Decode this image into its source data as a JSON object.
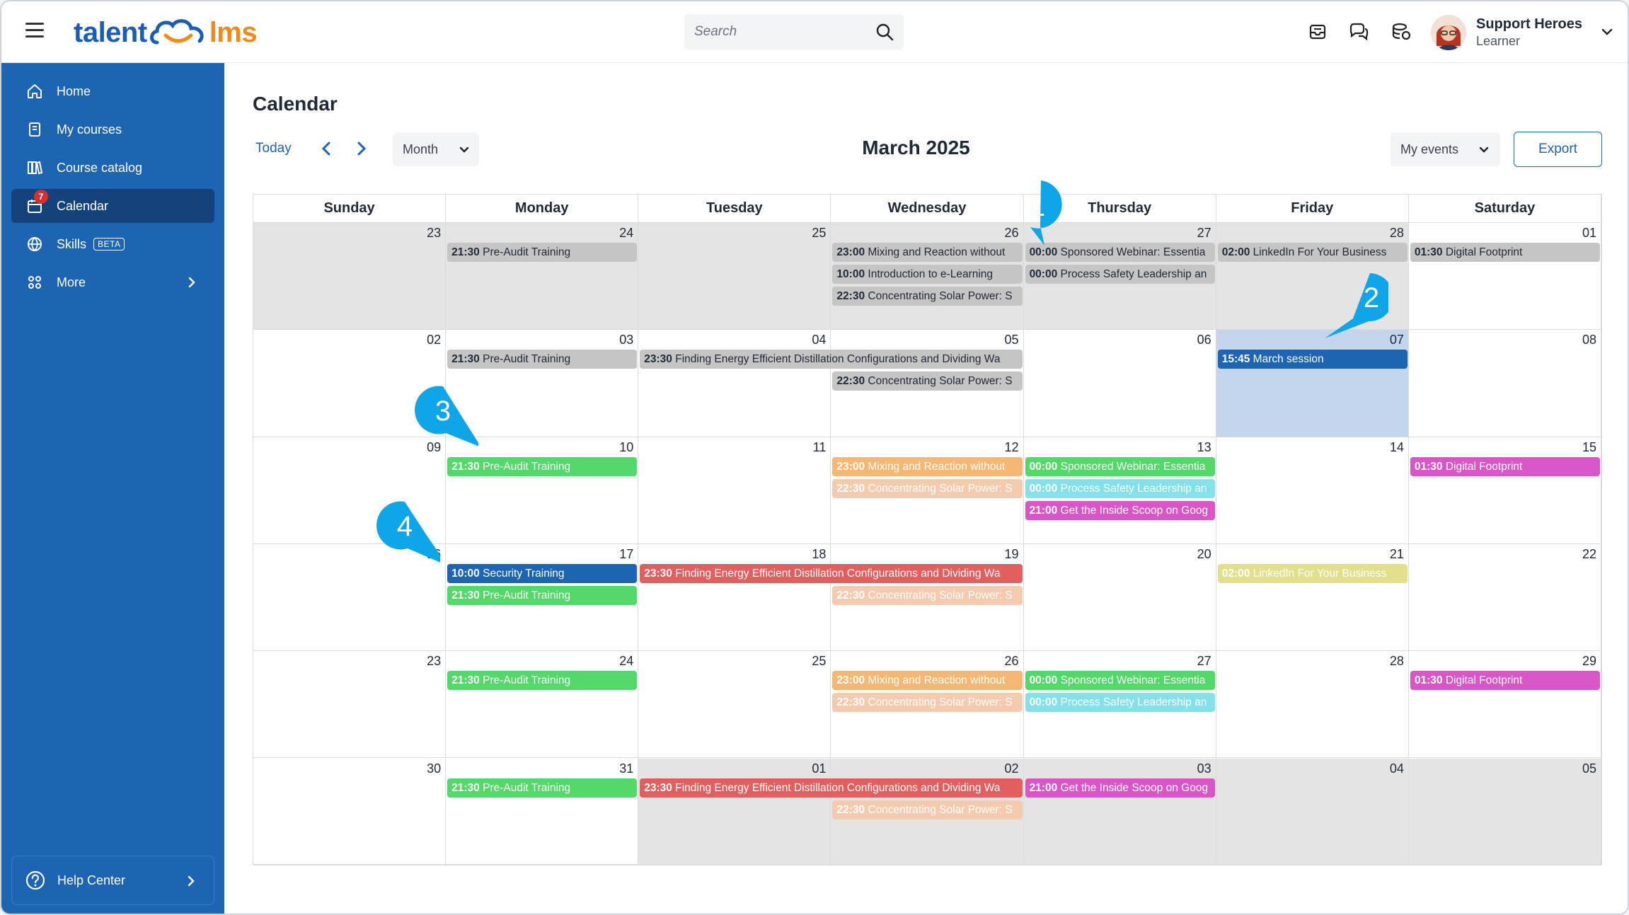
{
  "topbar": {
    "logo_left": "talent",
    "logo_right": "lms",
    "search_placeholder": "Search",
    "user_name": "Support Heroes",
    "user_role": "Learner"
  },
  "sidebar": {
    "items": [
      {
        "label": "Home",
        "icon": "home-icon"
      },
      {
        "label": "My courses",
        "icon": "book-icon"
      },
      {
        "label": "Course catalog",
        "icon": "catalog-icon"
      },
      {
        "label": "Calendar",
        "icon": "calendar-icon",
        "badge": "7",
        "active": true
      },
      {
        "label": "Skills",
        "icon": "globe-icon",
        "tag": "BETA"
      },
      {
        "label": "More",
        "icon": "grid-icon"
      }
    ],
    "help_label": "Help Center"
  },
  "main": {
    "title": "Calendar",
    "today_label": "Today",
    "view_select": "Month",
    "month_title": "March 2025",
    "events_filter": "My events",
    "export_label": "Export"
  },
  "calendar": {
    "weekdays": [
      "Sunday",
      "Monday",
      "Tuesday",
      "Wednesday",
      "Thursday",
      "Friday",
      "Saturday"
    ],
    "weeks": [
      [
        "23",
        "24",
        "25",
        "26",
        "27",
        "28",
        "01"
      ],
      [
        "02",
        "03",
        "04",
        "05",
        "06",
        "07",
        "08"
      ],
      [
        "09",
        "10",
        "11",
        "12",
        "13",
        "14",
        "15"
      ],
      [
        "16",
        "17",
        "18",
        "19",
        "20",
        "21",
        "22"
      ],
      [
        "23",
        "24",
        "25",
        "26",
        "27",
        "28",
        "29"
      ],
      [
        "30",
        "31",
        "01",
        "02",
        "03",
        "04",
        "05"
      ]
    ],
    "events": [
      {
        "w": 0,
        "d": 1,
        "row": 0,
        "span": 1,
        "time": "21:30",
        "title": "Pre-Audit Training",
        "color": "grey"
      },
      {
        "w": 0,
        "d": 3,
        "row": 0,
        "span": 1,
        "time": "23:00",
        "title": "Mixing and Reaction without",
        "color": "grey"
      },
      {
        "w": 0,
        "d": 3,
        "row": 1,
        "span": 1,
        "time": "10:00",
        "title": "Introduction to e-Learning",
        "color": "grey"
      },
      {
        "w": 0,
        "d": 3,
        "row": 2,
        "span": 1,
        "time": "22:30",
        "title": "Concentrating Solar Power: S",
        "color": "grey"
      },
      {
        "w": 0,
        "d": 4,
        "row": 0,
        "span": 1,
        "time": "00:00",
        "title": "Sponsored Webinar: Essentia",
        "color": "grey"
      },
      {
        "w": 0,
        "d": 4,
        "row": 1,
        "span": 1,
        "time": "00:00",
        "title": "Process Safety Leadership an",
        "color": "grey"
      },
      {
        "w": 0,
        "d": 5,
        "row": 0,
        "span": 1,
        "time": "02:00",
        "title": "LinkedIn For Your Business",
        "color": "grey"
      },
      {
        "w": 0,
        "d": 6,
        "row": 0,
        "span": 1,
        "time": "01:30",
        "title": "Digital Footprint",
        "color": "grey"
      },
      {
        "w": 1,
        "d": 1,
        "row": 0,
        "span": 1,
        "time": "21:30",
        "title": "Pre-Audit Training",
        "color": "grey"
      },
      {
        "w": 1,
        "d": 2,
        "row": 0,
        "span": 2,
        "time": "23:30",
        "title": "Finding Energy Efficient Distillation Configurations and Dividing Wa",
        "color": "grey"
      },
      {
        "w": 1,
        "d": 3,
        "row": 1,
        "span": 1,
        "time": "22:30",
        "title": "Concentrating Solar Power: S",
        "color": "grey"
      },
      {
        "w": 1,
        "d": 5,
        "row": 0,
        "span": 1,
        "time": "15:45",
        "title": "March session",
        "color": "blue"
      },
      {
        "w": 2,
        "d": 1,
        "row": 0,
        "span": 1,
        "time": "21:30",
        "title": "Pre-Audit Training",
        "color": "green"
      },
      {
        "w": 2,
        "d": 3,
        "row": 0,
        "span": 1,
        "time": "23:00",
        "title": "Mixing and Reaction without",
        "color": "orange"
      },
      {
        "w": 2,
        "d": 3,
        "row": 1,
        "span": 1,
        "time": "22:30",
        "title": "Concentrating Solar Power: S",
        "color": "peach"
      },
      {
        "w": 2,
        "d": 4,
        "row": 0,
        "span": 1,
        "time": "00:00",
        "title": "Sponsored Webinar: Essentia",
        "color": "green"
      },
      {
        "w": 2,
        "d": 4,
        "row": 1,
        "span": 1,
        "time": "00:00",
        "title": "Process Safety Leadership an",
        "color": "cyan"
      },
      {
        "w": 2,
        "d": 4,
        "row": 2,
        "span": 1,
        "time": "21:00",
        "title": "Get the Inside Scoop on Goog",
        "color": "magenta"
      },
      {
        "w": 2,
        "d": 6,
        "row": 0,
        "span": 1,
        "time": "01:30",
        "title": "Digital Footprint",
        "color": "magenta"
      },
      {
        "w": 3,
        "d": 1,
        "row": 0,
        "span": 1,
        "time": "10:00",
        "title": "Security Training",
        "color": "blue"
      },
      {
        "w": 3,
        "d": 1,
        "row": 1,
        "span": 1,
        "time": "21:30",
        "title": "Pre-Audit Training",
        "color": "green"
      },
      {
        "w": 3,
        "d": 2,
        "row": 0,
        "span": 2,
        "time": "23:30",
        "title": "Finding Energy Efficient Distillation Configurations and Dividing Wa",
        "color": "red"
      },
      {
        "w": 3,
        "d": 3,
        "row": 1,
        "span": 1,
        "time": "22:30",
        "title": "Concentrating Solar Power: S",
        "color": "peach"
      },
      {
        "w": 3,
        "d": 5,
        "row": 0,
        "span": 1,
        "time": "02:00",
        "title": "LinkedIn For Your Business",
        "color": "yellow"
      },
      {
        "w": 4,
        "d": 1,
        "row": 0,
        "span": 1,
        "time": "21:30",
        "title": "Pre-Audit Training",
        "color": "green"
      },
      {
        "w": 4,
        "d": 3,
        "row": 0,
        "span": 1,
        "time": "23:00",
        "title": "Mixing and Reaction without",
        "color": "orange"
      },
      {
        "w": 4,
        "d": 3,
        "row": 1,
        "span": 1,
        "time": "22:30",
        "title": "Concentrating Solar Power: S",
        "color": "peach"
      },
      {
        "w": 4,
        "d": 4,
        "row": 0,
        "span": 1,
        "time": "00:00",
        "title": "Sponsored Webinar: Essentia",
        "color": "green"
      },
      {
        "w": 4,
        "d": 4,
        "row": 1,
        "span": 1,
        "time": "00:00",
        "title": "Process Safety Leadership an",
        "color": "cyan"
      },
      {
        "w": 4,
        "d": 6,
        "row": 0,
        "span": 1,
        "time": "01:30",
        "title": "Digital Footprint",
        "color": "magenta"
      },
      {
        "w": 5,
        "d": 1,
        "row": 0,
        "span": 1,
        "time": "21:30",
        "title": "Pre-Audit Training",
        "color": "green"
      },
      {
        "w": 5,
        "d": 2,
        "row": 0,
        "span": 2,
        "time": "23:30",
        "title": "Finding Energy Efficient Distillation Configurations and Dividing Wa",
        "color": "red"
      },
      {
        "w": 5,
        "d": 3,
        "row": 1,
        "span": 1,
        "time": "22:30",
        "title": "Concentrating Solar Power: S",
        "color": "peach"
      },
      {
        "w": 5,
        "d": 4,
        "row": 0,
        "span": 1,
        "time": "21:00",
        "title": "Get the Inside Scoop on Goog",
        "color": "magenta"
      }
    ]
  },
  "callouts": [
    "1",
    "2",
    "3",
    "4"
  ],
  "colors": {
    "brand_blue": "#1d64b3",
    "brand_orange": "#f08a1c",
    "sidebar_active": "#14427a",
    "callout": "#0ea5e9"
  }
}
